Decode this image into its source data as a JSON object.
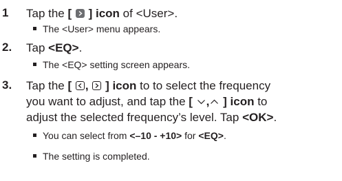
{
  "intro_clip": "Setup Step Icon",
  "steps": [
    {
      "number": "1",
      "line1_a": "Tap the ",
      "line1_bracket_open": "[ ",
      "line1_bracket_close": " ] icon",
      "line1_b": " of <User>.",
      "bullets": [
        "The <User> menu appears."
      ]
    },
    {
      "number": "2.",
      "line1_a": "Tap ",
      "line1_bold": "<EQ>",
      "line1_b": ".",
      "bullets": [
        "The <EQ> setting screen appears."
      ]
    },
    {
      "number": "3.",
      "line1_a": "Tap the ",
      "line1_bracket_open": "[ ",
      "line1_sep": ", ",
      "line1_bracket_close": " ] icon",
      "line1_b": " to to select the frequency",
      "line2": "you want to adjust, and tap the ",
      "line2_bracket_open": "[ ",
      "line2_sep": ",",
      "line2_bracket_close": " ] icon",
      "line2_b": " to",
      "line3_a": "adjust the selected frequency’s level. Tap ",
      "line3_bold": "<OK>",
      "line3_b": ".",
      "bullet1_a": "You can select from ",
      "bullet1_bold": "<–10 - +10>",
      "bullet1_mid": " for ",
      "bullet1_bold2": "<EQ>",
      "bullet1_end": ".",
      "bullet2": "The setting is completed."
    }
  ],
  "icons": {
    "step1": "right-arrow-filled-icon",
    "step3_left": "left-arrow-icon",
    "step3_right": "right-arrow-icon",
    "step3_down": "chevron-down-icon",
    "step3_up": "chevron-up-icon"
  }
}
